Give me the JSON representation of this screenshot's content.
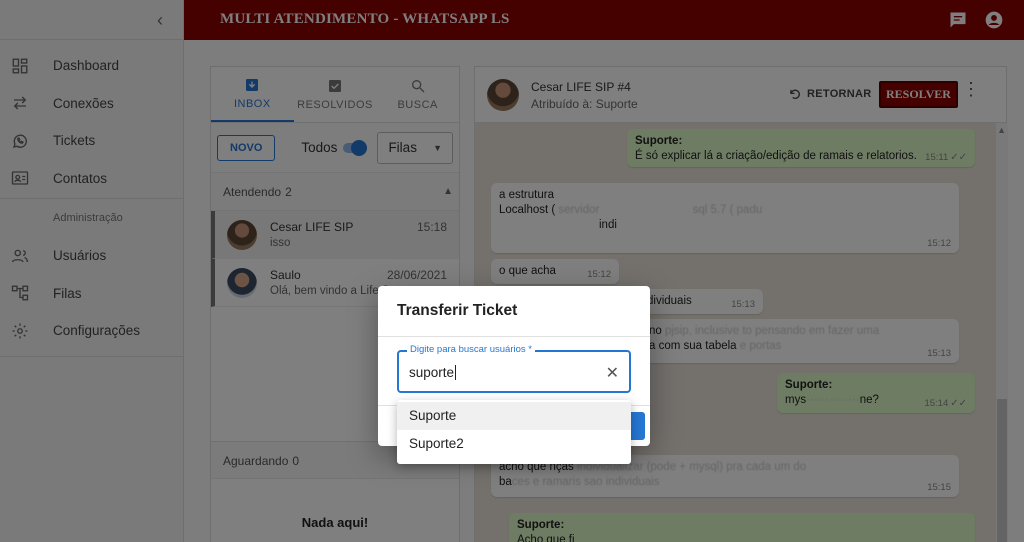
{
  "app": {
    "title": "MULTI ATENDIMENTO - WHATSAPP LS"
  },
  "sidebar": {
    "items": [
      {
        "label": "Dashboard",
        "icon": "dashboard-icon"
      },
      {
        "label": "Conexões",
        "icon": "swap-arrows-icon"
      },
      {
        "label": "Tickets",
        "icon": "whatsapp-icon"
      },
      {
        "label": "Contatos",
        "icon": "contact-card-icon"
      }
    ],
    "admin_header": "Administração",
    "admin_items": [
      {
        "label": "Usuários",
        "icon": "people-icon"
      },
      {
        "label": "Filas",
        "icon": "account-tree-icon"
      },
      {
        "label": "Configurações",
        "icon": "gear-icon"
      }
    ]
  },
  "tickets": {
    "tabs": [
      {
        "label": "INBOX",
        "icon": "inbox-icon"
      },
      {
        "label": "RESOLVIDOS",
        "icon": "check-box-icon"
      },
      {
        "label": "BUSCA",
        "icon": "search-icon"
      }
    ],
    "new_button": "NOVO",
    "todos_label": "Todos",
    "queue_select": "Filas",
    "attending": {
      "label": "Atendendo",
      "count": "2"
    },
    "list": [
      {
        "name": "Cesar LIFE SIP",
        "message": "isso",
        "time": "15:18"
      },
      {
        "name": "Saulo",
        "message": "Olá, bem vindo a Life S",
        "time": "28/06/2021"
      }
    ],
    "waiting": {
      "label": "Aguardando",
      "count": "0"
    },
    "empty_text": "Nada aqui!"
  },
  "chat": {
    "contact_name": "Cesar LIFE SIP #4",
    "assigned": "Atribuído à: Suporte",
    "return_label": "RETORNAR",
    "resolve_label": "RESOLVER",
    "messages": [
      {
        "sender": "Suporte:",
        "text": "É só explicar lá a criação/edição de ramais e relatorios.",
        "time": "15:11"
      },
      {
        "text1": "a estrutura",
        "text2": "Localhost ( ",
        "blur2": "servidor",
        "blur3": "sql 5.7 ( padu",
        "text3": "indi",
        "time": "15:12"
      },
      {
        "text": "o que acha",
        "time": "15:12"
      },
      {
        "text": "dividuais",
        "time": "15:13"
      },
      {
        "text1": "no ",
        "blur1": "pjsip, inclusive to pensando em fazer uma",
        "text2": "a com sua tabela ",
        "blur2": "e portas",
        "time": "15:13"
      },
      {
        "sender": "Suporte:",
        "text": "mys",
        "tail": "ne?",
        "time": "15:14"
      },
      {
        "text1": "acho que nças",
        "blur1": "individualizar (pode + mysql) pra cada um do",
        "text2": "ba",
        "blur2": "ces e ramaris sao individuais",
        "time": "15:15"
      },
      {
        "sender": "Suporte:",
        "text": "Acho que fi"
      }
    ]
  },
  "dialog": {
    "title": "Transferir Ticket",
    "field_label": "Digite para buscar usuários *",
    "field_value": "suporte",
    "options": [
      "Suporte",
      "Suporte2"
    ]
  }
}
